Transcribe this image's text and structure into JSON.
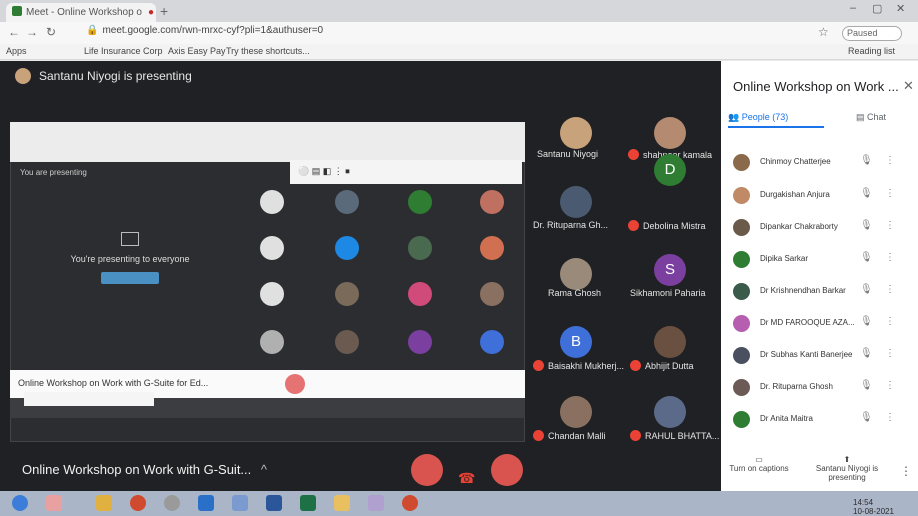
{
  "browser": {
    "tab_title": "Meet - Online Workshop o",
    "new_tab": "+",
    "url": "meet.google.com/rwn-mrxc-cyf?pli=1&authuser=0",
    "profile": "Paused",
    "bookmarks": [
      "Apps",
      "Life Insurance Corp",
      "Axis Easy Pay",
      "Try these shortcuts..."
    ],
    "reading_list": "Reading list"
  },
  "meet": {
    "presenting_banner": "Santanu Niyogi is presenting",
    "meeting_title": "Online Workshop on Work with G-Suit...",
    "caret": "^"
  },
  "shared_screen": {
    "you_presenting": "You are presenting",
    "presenting_to_everyone": "You're presenting to everyone",
    "stop_presenting": "Stop presenting",
    "bottom_title": "Online Workshop on Work with G-Suite for Ed..."
  },
  "participant_tiles": [
    {
      "name": "Santanu Niyogi",
      "color": "#c8a27a"
    },
    {
      "name": "shahnoor kamala",
      "color": "#b48a70"
    },
    {
      "name": "Dr. Rituparna Gh...",
      "color": "#4a5a70"
    },
    {
      "name": "Debolina Mistra",
      "letter": "D",
      "color": "#2e7d32"
    },
    {
      "name": "Rama Ghosh",
      "color": "#9a8a7a"
    },
    {
      "name": "Sikhamoni Paharia",
      "letter": "S",
      "color": "#7b3fa0"
    },
    {
      "name": "Baisakhi Mukherj...",
      "letter": "B",
      "color": "#3f6fd8"
    },
    {
      "name": "Abhijit Dutta",
      "color": "#6a5040"
    },
    {
      "name": "Chandan Malli",
      "color": "#8a7060"
    },
    {
      "name": "RAHUL BHATTA...",
      "color": "#5a6a88"
    }
  ],
  "panel": {
    "title": "Online Workshop on Work ...",
    "close": "✕",
    "people_tab": "People (73)",
    "chat_tab": "Chat",
    "participants": [
      {
        "name": "Chinmoy Chatterjee",
        "color": "#8a6a4a"
      },
      {
        "name": "Durgakishan Anjura",
        "color": "#c08a66"
      },
      {
        "name": "Dipankar Chakraborty",
        "color": "#6a5a4a"
      },
      {
        "name": "Dipika Sarkar",
        "color": "#2e7d32"
      },
      {
        "name": "Dr Krishnendhan Barkar",
        "color": "#3a5a4a"
      },
      {
        "name": "Dr MD FAROOQUE AZA...",
        "color": "#b65fb0"
      },
      {
        "name": "Dr Subhas Kanti Banerjee",
        "color": "#4a5060"
      },
      {
        "name": "Dr. Rituparna Ghosh",
        "color": "#6b5a55"
      },
      {
        "name": "Dr Anita Maitra",
        "color": "#2e7d32"
      }
    ],
    "captions_label": "Turn on captions",
    "presenter_label": "Santanu Niyogi is presenting"
  },
  "taskbar": {
    "time": "14:54",
    "date": "10-08-2021"
  }
}
